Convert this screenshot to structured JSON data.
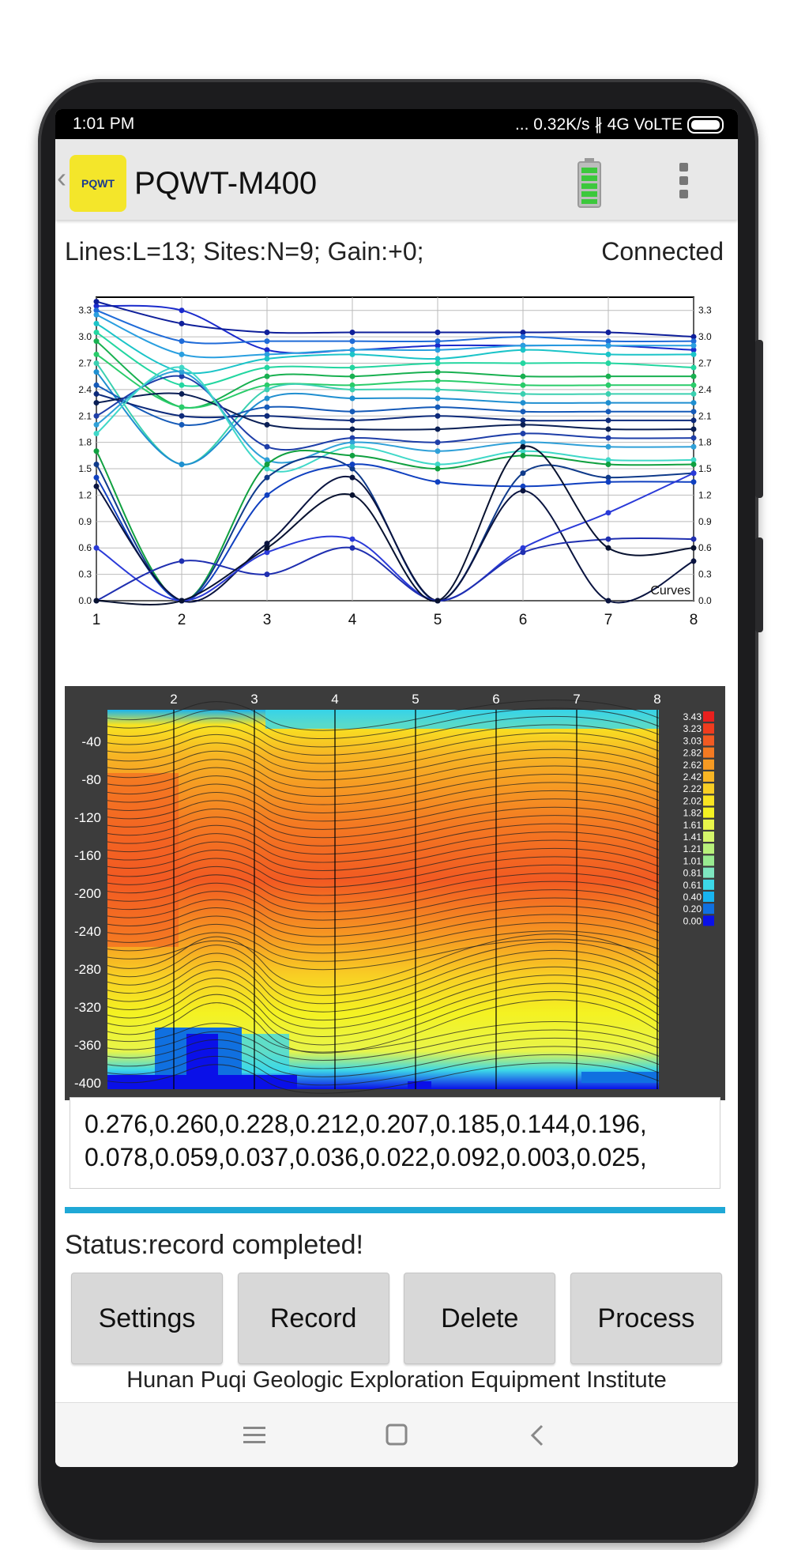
{
  "status_bar": {
    "time": "1:01 PM",
    "right_text": "... 0.32K/s ∦ 4G VoLTE",
    "icons": [
      "bluetooth-icon",
      "signal-icon",
      "battery-icon"
    ]
  },
  "app_bar": {
    "logo_text": "PQWT",
    "title": "PQWT-M400",
    "icons": [
      "back-chevron-icon",
      "battery-charge-icon",
      "overflow-menu-icon"
    ]
  },
  "info": {
    "text": "Lines:L=13;  Sites:N=9;  Gain:+0;",
    "connection": "Connected"
  },
  "chart_data": [
    {
      "type": "line",
      "title": "",
      "x": [
        1,
        2,
        3,
        4,
        5,
        6,
        7,
        8
      ],
      "ylim": [
        0,
        3.45
      ],
      "y_ticks": [
        "0.0",
        "0.3",
        "0.6",
        "0.9",
        "1.2",
        "1.5",
        "1.8",
        "2.1",
        "2.4",
        "2.7",
        "3.0",
        "3.3"
      ],
      "legend_label": "Curves",
      "grid": true,
      "series": [
        {
          "values": [
            3.35,
            3.3,
            2.85,
            2.85,
            2.9,
            2.9,
            2.9,
            2.85
          ]
        },
        {
          "values": [
            3.4,
            3.15,
            3.05,
            3.05,
            3.05,
            3.05,
            3.05,
            3.0
          ]
        },
        {
          "values": [
            3.3,
            2.95,
            2.95,
            2.95,
            2.95,
            3.0,
            2.95,
            2.95
          ]
        },
        {
          "values": [
            3.25,
            2.8,
            2.8,
            2.85,
            2.85,
            2.9,
            2.9,
            2.9
          ]
        },
        {
          "values": [
            3.15,
            2.6,
            2.75,
            2.8,
            2.75,
            2.85,
            2.8,
            2.8
          ]
        },
        {
          "values": [
            3.05,
            2.45,
            2.65,
            2.65,
            2.7,
            2.7,
            2.7,
            2.65
          ]
        },
        {
          "values": [
            2.95,
            2.2,
            2.55,
            2.55,
            2.6,
            2.55,
            2.55,
            2.55
          ]
        },
        {
          "values": [
            2.8,
            2.2,
            2.45,
            2.45,
            2.5,
            2.45,
            2.45,
            2.45
          ]
        },
        {
          "values": [
            2.7,
            1.55,
            2.4,
            2.4,
            2.4,
            2.35,
            2.35,
            2.35
          ]
        },
        {
          "values": [
            2.6,
            1.55,
            2.3,
            2.3,
            2.3,
            2.25,
            2.25,
            2.25
          ]
        },
        {
          "values": [
            2.45,
            2.0,
            2.2,
            2.15,
            2.2,
            2.15,
            2.15,
            2.15
          ]
        },
        {
          "values": [
            2.35,
            2.1,
            2.1,
            2.05,
            2.1,
            2.05,
            2.05,
            2.05
          ]
        },
        {
          "values": [
            2.25,
            2.35,
            2.0,
            1.95,
            1.95,
            2.0,
            1.95,
            1.95
          ]
        },
        {
          "values": [
            2.1,
            2.55,
            1.75,
            1.85,
            1.8,
            1.9,
            1.85,
            1.85
          ]
        },
        {
          "values": [
            2.0,
            2.6,
            1.6,
            1.8,
            1.7,
            1.8,
            1.75,
            1.75
          ]
        },
        {
          "values": [
            1.9,
            2.65,
            1.5,
            1.75,
            1.55,
            1.7,
            1.6,
            1.6
          ]
        },
        {
          "values": [
            1.7,
            0.0,
            1.55,
            1.65,
            1.5,
            1.65,
            1.55,
            1.55
          ]
        },
        {
          "values": [
            1.55,
            0.0,
            1.4,
            1.5,
            0.0,
            1.45,
            1.4,
            1.45
          ]
        },
        {
          "values": [
            1.4,
            0.0,
            1.2,
            1.55,
            1.35,
            1.3,
            1.35,
            1.35
          ]
        },
        {
          "values": [
            1.3,
            0.0,
            0.65,
            1.4,
            0.0,
            1.25,
            0.0,
            0.45
          ]
        },
        {
          "values": [
            0.6,
            0.0,
            0.55,
            0.7,
            0.0,
            0.6,
            1.0,
            1.45
          ]
        },
        {
          "values": [
            0.0,
            0.45,
            0.3,
            0.6,
            0.0,
            0.55,
            0.7,
            0.7
          ]
        },
        {
          "values": [
            0.0,
            0.0,
            0.6,
            1.2,
            0.0,
            1.75,
            0.6,
            0.6
          ]
        }
      ]
    },
    {
      "type": "heatmap",
      "title": "",
      "x_ticks": [
        "2",
        "3",
        "4",
        "5",
        "6",
        "7",
        "8"
      ],
      "y_ticks": [
        "-40",
        "-80",
        "-120",
        "-160",
        "-200",
        "-240",
        "-280",
        "-320",
        "-360",
        "-400"
      ],
      "legend": [
        {
          "value": "3.43",
          "color": "#e8201e"
        },
        {
          "value": "3.23",
          "color": "#f03c1e"
        },
        {
          "value": "3.03",
          "color": "#f25a22"
        },
        {
          "value": "2.82",
          "color": "#f47a22"
        },
        {
          "value": "2.62",
          "color": "#f69a22"
        },
        {
          "value": "2.42",
          "color": "#f7b524"
        },
        {
          "value": "2.22",
          "color": "#f8ce24"
        },
        {
          "value": "2.02",
          "color": "#f8e422"
        },
        {
          "value": "1.82",
          "color": "#f4f222"
        },
        {
          "value": "1.61",
          "color": "#e8f54a"
        },
        {
          "value": "1.41",
          "color": "#d4f56a"
        },
        {
          "value": "1.21",
          "color": "#b8f07a"
        },
        {
          "value": "1.01",
          "color": "#98ea90"
        },
        {
          "value": "0.81",
          "color": "#7ee6c0"
        },
        {
          "value": "0.61",
          "color": "#3cd8e8"
        },
        {
          "value": "0.40",
          "color": "#18b4f0"
        },
        {
          "value": "0.20",
          "color": "#1070e0"
        },
        {
          "value": "0.00",
          "color": "#0a10e8"
        }
      ]
    }
  ],
  "data_text": {
    "line1": "0.276,0.260,0.228,0.212,0.207,0.185,0.144,0.196,",
    "line2": "0.078,0.059,0.037,0.036,0.022,0.092,0.003,0.025,"
  },
  "status_text": "Status:record completed!",
  "buttons": {
    "settings": "Settings",
    "record": "Record",
    "delete": "Delete",
    "process": "Process"
  },
  "footer": "Hunan Puqi Geologic Exploration Equipment Institute",
  "nav": [
    "menu-icon",
    "home-square-icon",
    "back-icon"
  ]
}
